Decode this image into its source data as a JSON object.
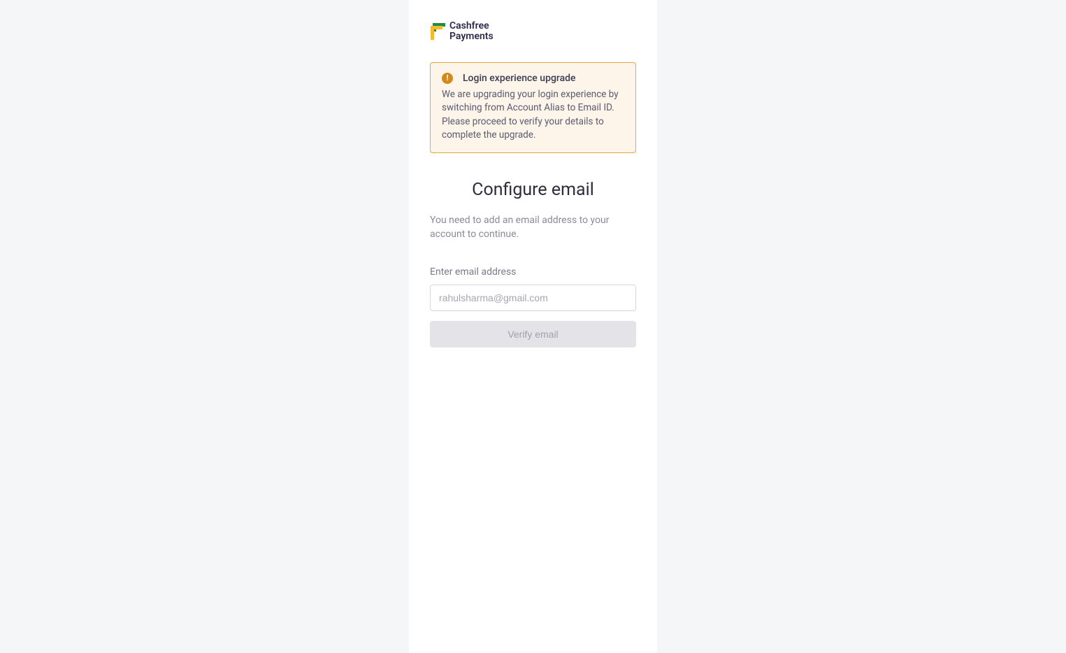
{
  "logo": {
    "line1": "Cashfree",
    "line2": "Payments"
  },
  "alert": {
    "title": "Login experience upgrade",
    "body": "We are upgrading your login experience by switching from Account Alias to Email ID. Please proceed to verify your details to complete the upgrade."
  },
  "heading": "Configure email",
  "subtext": "You need to add an email address to your account to continue.",
  "form": {
    "email_label": "Enter email address",
    "email_placeholder": "rahulsharma@gmail.com",
    "verify_button": "Verify email"
  }
}
